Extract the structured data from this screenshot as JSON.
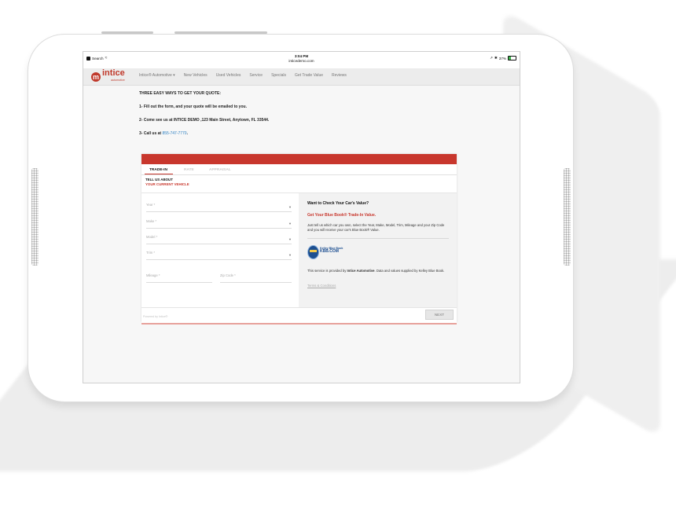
{
  "status_bar": {
    "app": "Search",
    "time": "3:04 PM",
    "url": "inticedemo.com",
    "battery": "37%"
  },
  "site": {
    "logo_word": "intice",
    "logo_sub": "automotive",
    "nav": [
      "Intice® Automotive ▾",
      "New Vehicles",
      "Used Vehicles",
      "Service",
      "Specials",
      "Get Trade Value",
      "Reviews"
    ]
  },
  "content": {
    "heading": "THREE EASY WAYS TO GET YOUR QUOTE:",
    "step1": "1- Fill out the form, and your quote will be emailed to you.",
    "step2": "2- Come see us at INTICE DEMO ,123 Main Street, Anytown, FL 33544.",
    "step3_prefix": "3- Call us at ",
    "phone": "855-747-7770",
    "step3_suffix": "."
  },
  "widget": {
    "tabs": [
      "TRADE-IN",
      "RATE",
      "APPRAISAL"
    ],
    "tell_us_line1": "TELL US ABOUT",
    "tell_us_line2": "YOUR CURRENT VEHICLE",
    "fields": {
      "year": "Year *",
      "make": "Make *",
      "model": "Model *",
      "trim": "Trim *",
      "mileage": "Mileage *",
      "zip": "Zip Code *"
    },
    "info_title": "Want to Check Your Car's Value?",
    "info_sub": "Get Your Blue Book® Trade-In Value.",
    "info_desc": "Just tell us which car you own, select the Year, Make, Model, Trim, Mileage and your Zip Code and you will receive your car's Blue Book® Value.",
    "kbb_small": "Kelley Blue Book",
    "kbb_big": "KBB.COM",
    "provided_prefix": "This service is provided by ",
    "provided_bold": "Intice Automotive",
    "provided_suffix": ". Data and values supplied by Kelley Blue Book.",
    "terms": "Terms & Conditions",
    "powered": "Powered by Intice®",
    "next": "NEXT"
  }
}
